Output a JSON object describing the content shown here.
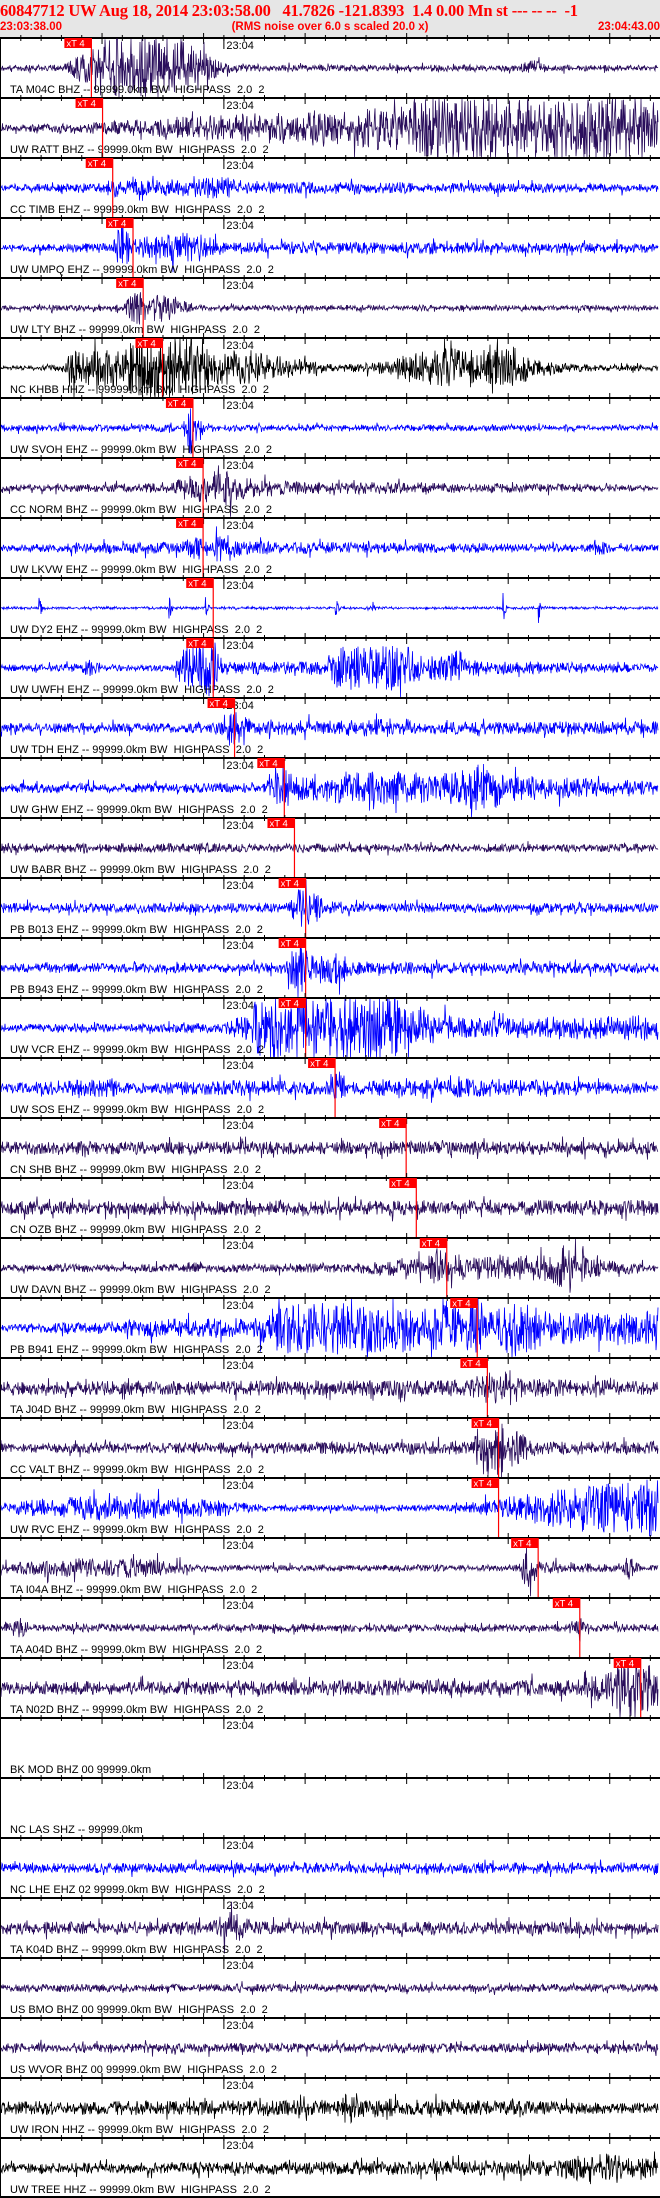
{
  "header": {
    "title": "60847712 UW Aug 18, 2014 23:03:58.00   41.7826 -121.8393  1.4 0.00 Mn st --- -- --  -1",
    "start_time": "23:03:38.00",
    "subtitle": "(RMS noise over 6.0 s scaled 20.0 x)",
    "end_time": "23:04:43.00"
  },
  "colors": {
    "header_text": "#ff0000",
    "header_bg": "#e6e6e6",
    "pick": "#ff0000",
    "bhz": "#2a0e5c",
    "ehz": "#0000ff",
    "hhz": "#000000"
  },
  "chart_data": {
    "type": "line",
    "title": "60847712 UW Aug 18, 2014 23:03:58.00",
    "x_unit": "seconds after 23:03:38.00",
    "xlim": [
      0,
      65
    ],
    "time_mark_label": "23:04",
    "time_mark_at": 22,
    "major_tick_every": 10,
    "minor_tick_every": 2,
    "pick_label": "xT 4",
    "tracks": [
      {
        "label": "TA M04C BHZ -- 99999.0km BW  HIGHPASS  2.0  2",
        "color": "bhz",
        "pick": 9.0,
        "env": [
          [
            0,
            0.08
          ],
          [
            6,
            0.1
          ],
          [
            8,
            0.4
          ],
          [
            10,
            0.9
          ],
          [
            14,
            1.0
          ],
          [
            18,
            0.9
          ],
          [
            20,
            0.5
          ],
          [
            22,
            0.2
          ],
          [
            25,
            0.1
          ],
          [
            51,
            0.1
          ],
          [
            52.5,
            0.25
          ],
          [
            54,
            0.1
          ],
          [
            65,
            0.08
          ]
        ]
      },
      {
        "label": "UW RATT BHZ -- 99999.0km BW  HIGHPASS  2.0  2",
        "color": "bhz",
        "pick": 10.1,
        "env": [
          [
            0,
            0.1
          ],
          [
            8,
            0.15
          ],
          [
            18,
            0.35
          ],
          [
            28,
            0.5
          ],
          [
            33,
            0.6
          ],
          [
            40,
            0.7
          ],
          [
            43,
            1
          ],
          [
            63,
            1
          ],
          [
            65,
            0.5
          ]
        ]
      },
      {
        "label": "CC TIMB EHZ -- 99999.0km BW  HIGHPASS  2.0  2",
        "color": "ehz",
        "pick": 11.1,
        "env": [
          [
            0,
            0.12
          ],
          [
            10,
            0.15
          ],
          [
            11,
            0.3
          ],
          [
            13,
            0.2
          ],
          [
            22,
            0.35
          ],
          [
            25,
            0.2
          ],
          [
            65,
            0.12
          ]
        ]
      },
      {
        "label": "UW UMPQ EHZ -- 99999.0km BW  HIGHPASS  2.0  2",
        "color": "ehz",
        "pick": 13.1,
        "env": [
          [
            0,
            0.12
          ],
          [
            11,
            0.15
          ],
          [
            12,
            0.8
          ],
          [
            13,
            0.3
          ],
          [
            19,
            0.5
          ],
          [
            22,
            0.2
          ],
          [
            65,
            0.15
          ]
        ]
      },
      {
        "label": "UW LTY BHZ -- 99999.0km BW  HIGHPASS  2.0  2",
        "color": "bhz",
        "pick": 14.1,
        "env": [
          [
            0,
            0.08
          ],
          [
            12,
            0.1
          ],
          [
            13.5,
            0.6
          ],
          [
            14.5,
            0.3
          ],
          [
            16,
            0.5
          ],
          [
            17,
            0.4
          ],
          [
            19,
            0.1
          ],
          [
            65,
            0.08
          ]
        ]
      },
      {
        "label": "NC KHBB HHZ -- 99999.0km BW  HIGHPASS  2.0  2",
        "color": "hhz",
        "pick": 16.0,
        "env": [
          [
            0,
            0.05
          ],
          [
            6,
            0.1
          ],
          [
            7,
            0.5
          ],
          [
            12,
            0.6
          ],
          [
            14,
            1
          ],
          [
            19,
            1
          ],
          [
            21,
            0.6
          ],
          [
            27,
            0.4
          ],
          [
            33,
            0.1
          ],
          [
            38,
            0.2
          ],
          [
            42,
            0.6
          ],
          [
            50,
            0.6
          ],
          [
            54,
            0.2
          ],
          [
            58,
            0.1
          ],
          [
            65,
            0.08
          ]
        ]
      },
      {
        "label": "UW SVOH EHZ -- 99999.0km BW  HIGHPASS  2.0  2",
        "color": "ehz",
        "pick": 19.0,
        "env": [
          [
            0,
            0.1
          ],
          [
            18,
            0.12
          ],
          [
            18.8,
            0.9
          ],
          [
            19.5,
            0.3
          ],
          [
            21,
            0.1
          ],
          [
            65,
            0.1
          ]
        ]
      },
      {
        "label": "CC NORM BHZ -- 99999.0km BW  HIGHPASS  2.0  2",
        "color": "bhz",
        "pick": 20.0,
        "env": [
          [
            0,
            0.1
          ],
          [
            17,
            0.15
          ],
          [
            18,
            0.35
          ],
          [
            22,
            0.6
          ],
          [
            25,
            0.3
          ],
          [
            29,
            0.2
          ],
          [
            65,
            0.1
          ]
        ]
      },
      {
        "label": "UW LKVW EHZ -- 99999.0km BW  HIGHPASS  2.0  2",
        "color": "ehz",
        "pick": 20.0,
        "env": [
          [
            0,
            0.1
          ],
          [
            18,
            0.2
          ],
          [
            19.5,
            0.4
          ],
          [
            21,
            0.2
          ],
          [
            21.5,
            0.55
          ],
          [
            24,
            0.2
          ],
          [
            58,
            0.12
          ],
          [
            59,
            0.3
          ],
          [
            60,
            0.12
          ],
          [
            65,
            0.1
          ]
        ]
      },
      {
        "label": "UW DY2 EHZ -- 99999.0km BW  HIGHPASS  2.0  2",
        "color": "ehz",
        "pick": 21.0,
        "env": [
          [
            0,
            0.04
          ],
          [
            65,
            0.04
          ]
        ],
        "spikes": [
          3.8,
          16.6,
          20.2,
          33,
          36.6,
          49.5,
          53
        ]
      },
      {
        "label": "UW UWFH EHZ -- 99999.0km BW  HIGHPASS  2.0  2",
        "color": "ehz",
        "pick": 21.0,
        "env": [
          [
            0,
            0.1
          ],
          [
            8,
            0.12
          ],
          [
            9,
            0.4
          ],
          [
            10,
            0.1
          ],
          [
            17,
            0.1
          ],
          [
            18,
            0.6
          ],
          [
            21,
            0.9
          ],
          [
            22,
            0.2
          ],
          [
            32,
            0.2
          ],
          [
            33,
            0.7
          ],
          [
            40,
            0.7
          ],
          [
            42,
            0.3
          ],
          [
            45,
            0.6
          ],
          [
            47,
            0.2
          ],
          [
            65,
            0.12
          ]
        ]
      },
      {
        "label": "UW TDH EHZ -- 99999.0km BW  HIGHPASS  2.0  2",
        "color": "ehz",
        "pick": 23.1,
        "env": [
          [
            0,
            0.15
          ],
          [
            21,
            0.15
          ],
          [
            23,
            0.6
          ],
          [
            25,
            0.2
          ],
          [
            40,
            0.3
          ],
          [
            41,
            0.2
          ],
          [
            65,
            0.2
          ]
        ]
      },
      {
        "label": "UW GHW EHZ -- 99999.0km BW  HIGHPASS  2.0  2",
        "color": "ehz",
        "pick": 28.0,
        "env": [
          [
            0,
            0.15
          ],
          [
            26,
            0.15
          ],
          [
            28,
            0.7
          ],
          [
            30,
            0.4
          ],
          [
            33,
            0.5
          ],
          [
            45,
            0.5
          ],
          [
            48,
            0.8
          ],
          [
            50,
            0.4
          ],
          [
            65,
            0.2
          ]
        ]
      },
      {
        "label": "UW BABR BHZ -- 99999.0km BW  HIGHPASS  2.0  2",
        "color": "bhz",
        "pick": 29.0,
        "env": [
          [
            0,
            0.15
          ],
          [
            65,
            0.12
          ]
        ]
      },
      {
        "label": "PB B013 EHZ -- 99999.0km BW  HIGHPASS  2.0  2",
        "color": "ehz",
        "pick": 30.1,
        "env": [
          [
            0,
            0.15
          ],
          [
            28,
            0.15
          ],
          [
            29.5,
            0.6
          ],
          [
            32,
            0.35
          ],
          [
            34,
            0.15
          ],
          [
            65,
            0.15
          ]
        ]
      },
      {
        "label": "PB B943 EHZ -- 99999.0km BW  HIGHPASS  2.0  2",
        "color": "ehz",
        "pick": 30.1,
        "env": [
          [
            0,
            0.15
          ],
          [
            28,
            0.15
          ],
          [
            29.5,
            1
          ],
          [
            30.5,
            0.4
          ],
          [
            33,
            0.6
          ],
          [
            35,
            0.2
          ],
          [
            65,
            0.15
          ]
        ]
      },
      {
        "label": "UW VCR EHZ -- 99999.0km BW  HIGHPASS  2.0  2",
        "color": "ehz",
        "pick": 30.1,
        "env": [
          [
            0,
            0.12
          ],
          [
            22,
            0.15
          ],
          [
            24,
            0.4
          ],
          [
            26,
            1
          ],
          [
            40,
            1
          ],
          [
            42,
            0.5
          ],
          [
            46,
            0.3
          ],
          [
            65,
            0.4
          ]
        ]
      },
      {
        "label": "UW SOS EHZ -- 99999.0km BW  HIGHPASS  2.0  2",
        "color": "ehz",
        "pick": 33.0,
        "env": [
          [
            0,
            0.15
          ],
          [
            11,
            0.3
          ],
          [
            13,
            0.15
          ],
          [
            24,
            0.25
          ],
          [
            32,
            0.2
          ],
          [
            33,
            0.6
          ],
          [
            35,
            0.2
          ],
          [
            40,
            0.35
          ],
          [
            46,
            0.3
          ],
          [
            65,
            0.15
          ]
        ]
      },
      {
        "label": "CN SHB BHZ -- 99999.0km BW  HIGHPASS  2.0  2",
        "color": "bhz",
        "pick": 40.0,
        "env": [
          [
            0,
            0.2
          ],
          [
            65,
            0.2
          ]
        ]
      },
      {
        "label": "CN OZB BHZ -- 99999.0km BW  HIGHPASS  2.0  2",
        "color": "bhz",
        "pick": 41.0,
        "env": [
          [
            0,
            0.2
          ],
          [
            65,
            0.25
          ]
        ]
      },
      {
        "label": "UW DAVN BHZ -- 99999.0km BW  HIGHPASS  2.0  2",
        "color": "bhz",
        "pick": 44.0,
        "env": [
          [
            0,
            0.1
          ],
          [
            34,
            0.15
          ],
          [
            42,
            0.3
          ],
          [
            43,
            0.6
          ],
          [
            46,
            0.35
          ],
          [
            54,
            0.4
          ],
          [
            56,
            0.8
          ],
          [
            58,
            0.3
          ],
          [
            65,
            0.1
          ]
        ]
      },
      {
        "label": "PB B941 EHZ -- 99999.0km BW  HIGHPASS  2.0  2",
        "color": "ehz",
        "pick": 47.0,
        "env": [
          [
            0,
            0.1
          ],
          [
            18,
            0.3
          ],
          [
            25,
            0.3
          ],
          [
            28,
            0.8
          ],
          [
            46,
            0.7
          ],
          [
            46.5,
            1
          ],
          [
            48,
            0.5
          ],
          [
            51,
            0.9
          ],
          [
            54,
            0.5
          ],
          [
            65,
            0.5
          ]
        ]
      },
      {
        "label": "TA J04D BHZ -- 99999.0km BW  HIGHPASS  2.0  2",
        "color": "bhz",
        "pick": 48.0,
        "env": [
          [
            0,
            0.2
          ],
          [
            46,
            0.25
          ],
          [
            48,
            0.5
          ],
          [
            50,
            0.3
          ],
          [
            65,
            0.2
          ]
        ]
      },
      {
        "label": "CC VALT BHZ -- 99999.0km BW  HIGHPASS  2.0  2",
        "color": "bhz",
        "pick": 49.1,
        "env": [
          [
            0,
            0.15
          ],
          [
            46,
            0.2
          ],
          [
            48,
            1
          ],
          [
            51,
            0.5
          ],
          [
            53,
            0.2
          ],
          [
            65,
            0.2
          ]
        ]
      },
      {
        "label": "UW RVC EHZ -- 99999.0km BW  HIGHPASS  2.0  2",
        "color": "ehz",
        "pick": 49.1,
        "env": [
          [
            0,
            0.15
          ],
          [
            8,
            0.4
          ],
          [
            20,
            0.3
          ],
          [
            26,
            0.1
          ],
          [
            45,
            0.1
          ],
          [
            49,
            0.3
          ],
          [
            55,
            0.6
          ],
          [
            65,
            0.9
          ]
        ]
      },
      {
        "label": "TA I04A BHZ -- 99999.0km BW  HIGHPASS  2.0  2",
        "color": "bhz",
        "pick": 53.0,
        "env": [
          [
            0,
            0.15
          ],
          [
            6,
            0.3
          ],
          [
            15,
            0.3
          ],
          [
            20,
            0.1
          ],
          [
            51,
            0.1
          ],
          [
            52,
            0.8
          ],
          [
            53,
            0.2
          ],
          [
            61,
            0.1
          ],
          [
            62,
            0.4
          ],
          [
            63,
            0.1
          ],
          [
            65,
            0.1
          ]
        ]
      },
      {
        "label": "TA A04D BHZ -- 99999.0km BW  HIGHPASS  2.0  2",
        "color": "bhz",
        "pick": 57.1,
        "env": [
          [
            0,
            0.12
          ],
          [
            2,
            0.35
          ],
          [
            3,
            0.12
          ],
          [
            56,
            0.12
          ],
          [
            57,
            0.5
          ],
          [
            58,
            0.12
          ],
          [
            65,
            0.12
          ]
        ]
      },
      {
        "label": "TA N02D BHZ -- 99999.0km BW  HIGHPASS  2.0  2",
        "color": "bhz",
        "pick": 63.1,
        "env": [
          [
            0,
            0.2
          ],
          [
            57,
            0.25
          ],
          [
            60,
            0.5
          ],
          [
            62,
            1
          ],
          [
            65,
            0.6
          ]
        ]
      },
      {
        "label": "BK MOD BHZ 00 99999.0km",
        "color": "bhz",
        "pick": null,
        "env": []
      },
      {
        "label": "NC LAS SHZ -- 99999.0km",
        "color": "bhz",
        "pick": null,
        "env": []
      },
      {
        "label": "NC LHE EHZ 02 99999.0km BW  HIGHPASS  2.0  2",
        "color": "ehz",
        "pick": null,
        "env": [
          [
            0,
            0.15
          ],
          [
            65,
            0.18
          ]
        ]
      },
      {
        "label": "TA K04D BHZ -- 99999.0km BW  HIGHPASS  2.0  2",
        "color": "bhz",
        "pick": null,
        "env": [
          [
            0,
            0.2
          ],
          [
            21,
            0.2
          ],
          [
            22.5,
            0.55
          ],
          [
            25,
            0.2
          ],
          [
            65,
            0.2
          ]
        ]
      },
      {
        "label": "US BMO BHZ 00 99999.0km BW  HIGHPASS  2.0  2",
        "color": "bhz",
        "pick": null,
        "env": [
          [
            0,
            0.12
          ],
          [
            65,
            0.12
          ]
        ]
      },
      {
        "label": "US WVOR BHZ 00 99999.0km BW  HIGHPASS  2.0  2",
        "color": "bhz",
        "pick": null,
        "env": [
          [
            0,
            0.15
          ],
          [
            65,
            0.15
          ]
        ]
      },
      {
        "label": "UW IRON HHZ -- 99999.0km BW  HIGHPASS  2.0  2",
        "color": "hhz",
        "pick": null,
        "env": [
          [
            0,
            0.2
          ],
          [
            33,
            0.25
          ],
          [
            34,
            0.7
          ],
          [
            35,
            0.3
          ],
          [
            65,
            0.15
          ]
        ]
      },
      {
        "label": "UW TREE HHZ -- 99999.0km BW  HIGHPASS  2.0  2",
        "color": "hhz",
        "pick": null,
        "env": [
          [
            0,
            0.15
          ],
          [
            55,
            0.25
          ],
          [
            58,
            0.5
          ],
          [
            62,
            0.35
          ],
          [
            65,
            0.3
          ]
        ]
      }
    ]
  }
}
